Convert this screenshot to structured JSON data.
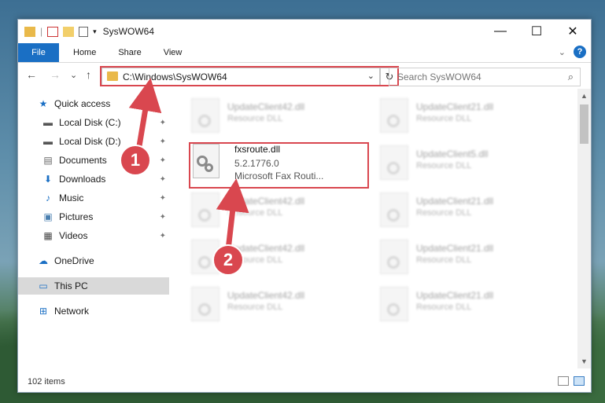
{
  "window": {
    "title": "SysWOW64",
    "controls": {
      "minimize": "—",
      "maximize": "☐",
      "close": "✕"
    }
  },
  "ribbon": {
    "tabs": [
      "File",
      "Home",
      "Share",
      "View"
    ],
    "help": "?"
  },
  "navigation": {
    "back": "←",
    "forward": "→",
    "recent": "⌄",
    "up": "↑",
    "address": "C:\\Windows\\SysWOW64",
    "address_dropdown": "⌄",
    "refresh": "↻",
    "search_placeholder": "Search SysWOW64",
    "search_icon": "⌕"
  },
  "sidebar": {
    "items": [
      {
        "label": "Quick access",
        "icon": "star-icon",
        "glyph": "★",
        "color": "#1a6fc4"
      },
      {
        "label": "Local Disk (C:)",
        "icon": "drive-icon",
        "glyph": "▬",
        "pinned": true
      },
      {
        "label": "Local Disk (D:)",
        "icon": "drive-icon",
        "glyph": "▬",
        "pinned": true
      },
      {
        "label": "Documents",
        "icon": "documents-icon",
        "glyph": "▤",
        "pinned": true
      },
      {
        "label": "Downloads",
        "icon": "download-icon",
        "glyph": "⬇",
        "color": "#1a6fc4",
        "pinned": true
      },
      {
        "label": "Music",
        "icon": "music-icon",
        "glyph": "♪",
        "color": "#1a6fc4",
        "pinned": true
      },
      {
        "label": "Pictures",
        "icon": "pictures-icon",
        "glyph": "▣",
        "pinned": true
      },
      {
        "label": "Videos",
        "icon": "videos-icon",
        "glyph": "▦",
        "pinned": true
      },
      {
        "label": "OneDrive",
        "icon": "cloud-icon",
        "glyph": "☁",
        "color": "#1a6fc4"
      },
      {
        "label": "This PC",
        "icon": "computer-icon",
        "glyph": "▭",
        "color": "#1a6fc4",
        "selected": true
      },
      {
        "label": "Network",
        "icon": "network-icon",
        "glyph": "⊞",
        "color": "#1a6fc4"
      }
    ],
    "pin_glyph": "📌"
  },
  "files": {
    "highlighted": {
      "name": "fxsroute.dll",
      "version": "5.2.1776.0",
      "description": "Microsoft Fax Routi..."
    },
    "ghost": [
      {
        "name": "UpdateClient42.dll",
        "type": "Resource DLL"
      },
      {
        "name": "UpdateClient21.dll",
        "type": "Resource DLL"
      },
      {
        "name": "UpdateClient5.dll",
        "type": "Resource DLL"
      },
      {
        "name": "UpdateClient42.dll",
        "type": "Resource DLL"
      },
      {
        "name": "UpdateClient21.dll",
        "type": "Resource DLL"
      },
      {
        "name": "UpdateClient42.dll",
        "type": "Resource DLL"
      },
      {
        "name": "UpdateClient21.dll",
        "type": "Resource DLL"
      },
      {
        "name": "UpdateClient42.dll",
        "type": "Resource DLL"
      },
      {
        "name": "UpdateClient21.dll",
        "type": "Resource DLL"
      }
    ]
  },
  "status": {
    "item_count": "102 items"
  },
  "callouts": {
    "step1": "1",
    "step2": "2"
  },
  "colors": {
    "accent": "#1a6fc4",
    "highlight": "#d9474f"
  }
}
